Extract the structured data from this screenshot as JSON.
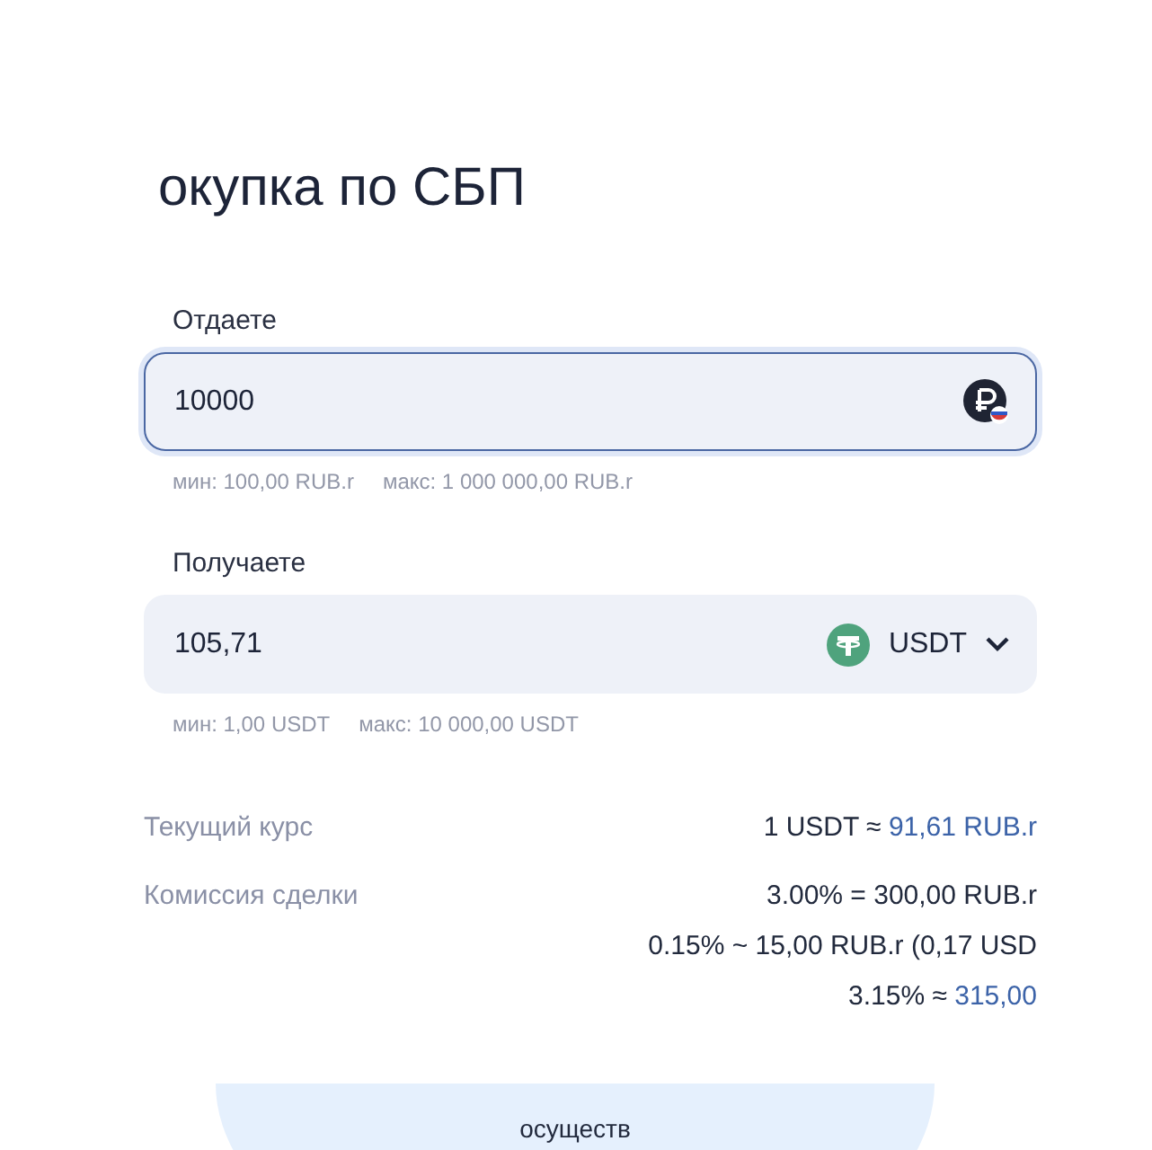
{
  "title": "окупка по СБП",
  "fields": [
    {
      "label": "Отдаете",
      "value": "10000",
      "focused": true,
      "kind": "rub",
      "hints": [
        "мин: 100,00 RUB.r",
        "макс: 1 000 000,00 RUB.r"
      ]
    },
    {
      "label": "Получаете",
      "value": "105,71",
      "focused": false,
      "kind": "select",
      "currency": "USDT",
      "hints": [
        "мин: 1,00 USDT",
        "макс: 10 000,00 USDT"
      ]
    }
  ],
  "info": [
    {
      "label": "Текущий курс",
      "value": "1 USDT ≈ ",
      "accent": "91,61 RUB.r"
    },
    {
      "label": "Комиссия сделки",
      "value": "3.00% = 300,00 RUB.r"
    },
    {
      "value": "0.15% ~ 15,00 RUB.r (0,17 USD"
    },
    {
      "value": "3.15% ≈ ",
      "accent": "315,00"
    }
  ],
  "footer_text": "осуществ"
}
